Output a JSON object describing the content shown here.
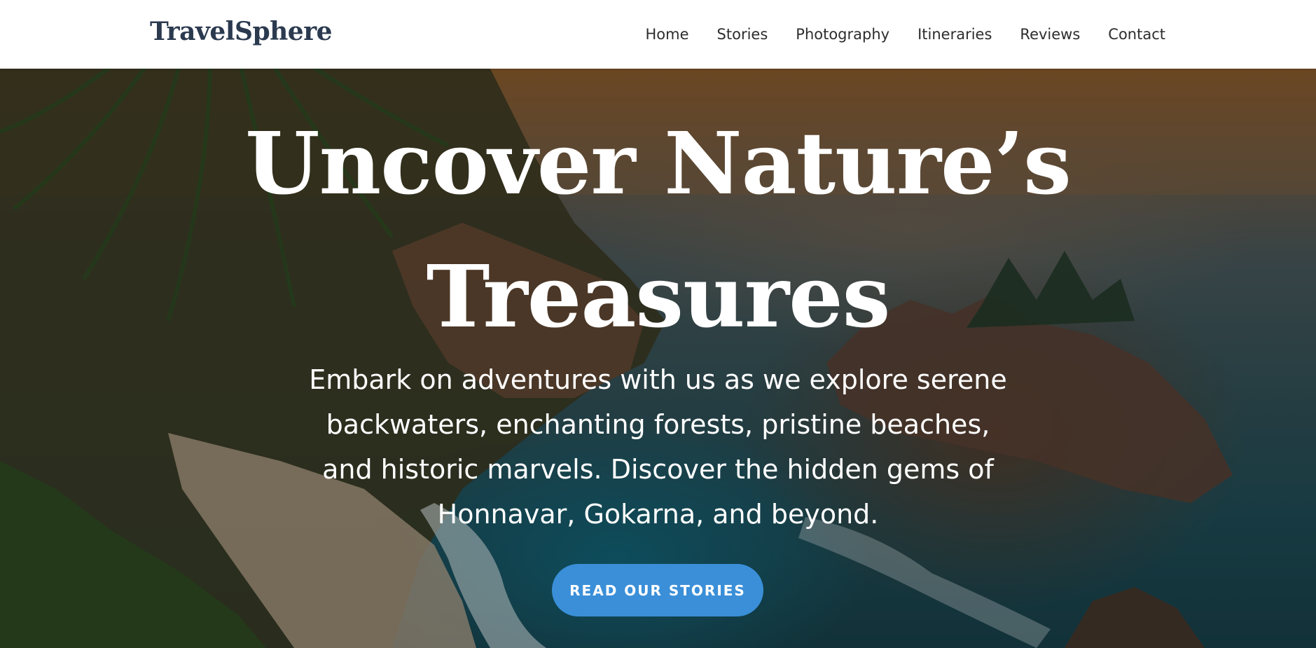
{
  "brand": {
    "name": "TravelSphere"
  },
  "nav": {
    "links": [
      "Home",
      "Stories",
      "Photography",
      "Itineraries",
      "Reviews",
      "Contact"
    ]
  },
  "hero": {
    "title_line1": "Uncover Nature’s",
    "title_line2": "Treasures",
    "description": "Embark on adventures with us as we explore serene backwaters, enchanting forests, pristine beaches, and historic marvels. Discover the hidden gems of Honnavar, Gokarna, and beyond.",
    "cta_label": "READ OUR STORIES"
  },
  "colors": {
    "brand_text": "#2b3a4f",
    "cta_background": "#3a8fd8",
    "nav_background": "#ffffff"
  }
}
